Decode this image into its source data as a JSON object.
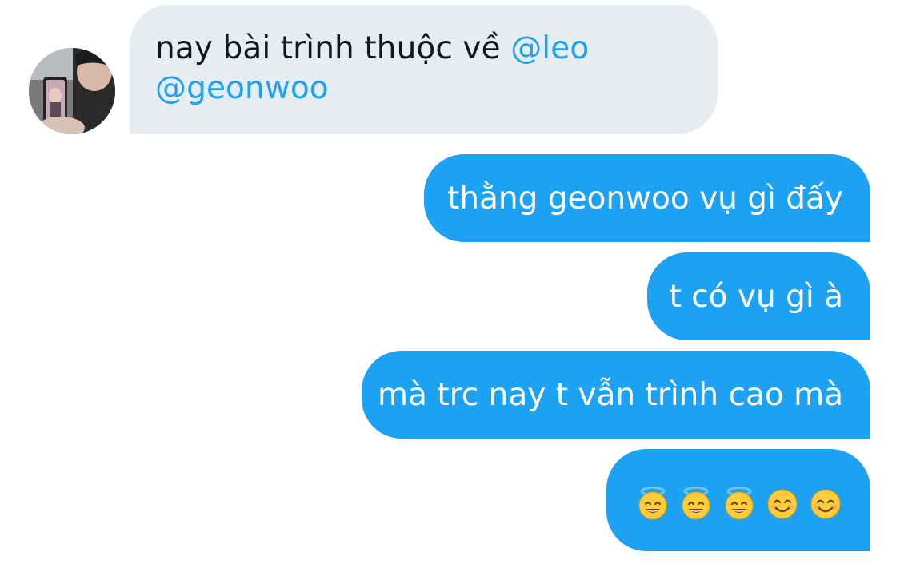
{
  "messages": {
    "received": {
      "text_line1": "nay bài trình thuộc về ",
      "mention1": "@leo",
      "mention2": "@geonwoo"
    },
    "sent": [
      "thằng geonwoo vụ gì đấy",
      "t có vụ gì à",
      "mà trc nay t vẫn trình cao mà"
    ],
    "emoji": [
      "smiling-face-with-halo",
      "smiling-face-with-halo",
      "smiling-face-with-halo",
      "smiling-face-with-smiling-eyes",
      "smiling-face-with-smiling-eyes"
    ]
  },
  "colors": {
    "received_bubble": "#e6ecf0",
    "sent_bubble": "#1da1f2",
    "mention": "#1da1f2",
    "text_dark": "#14171a",
    "text_light": "#ffffff"
  }
}
